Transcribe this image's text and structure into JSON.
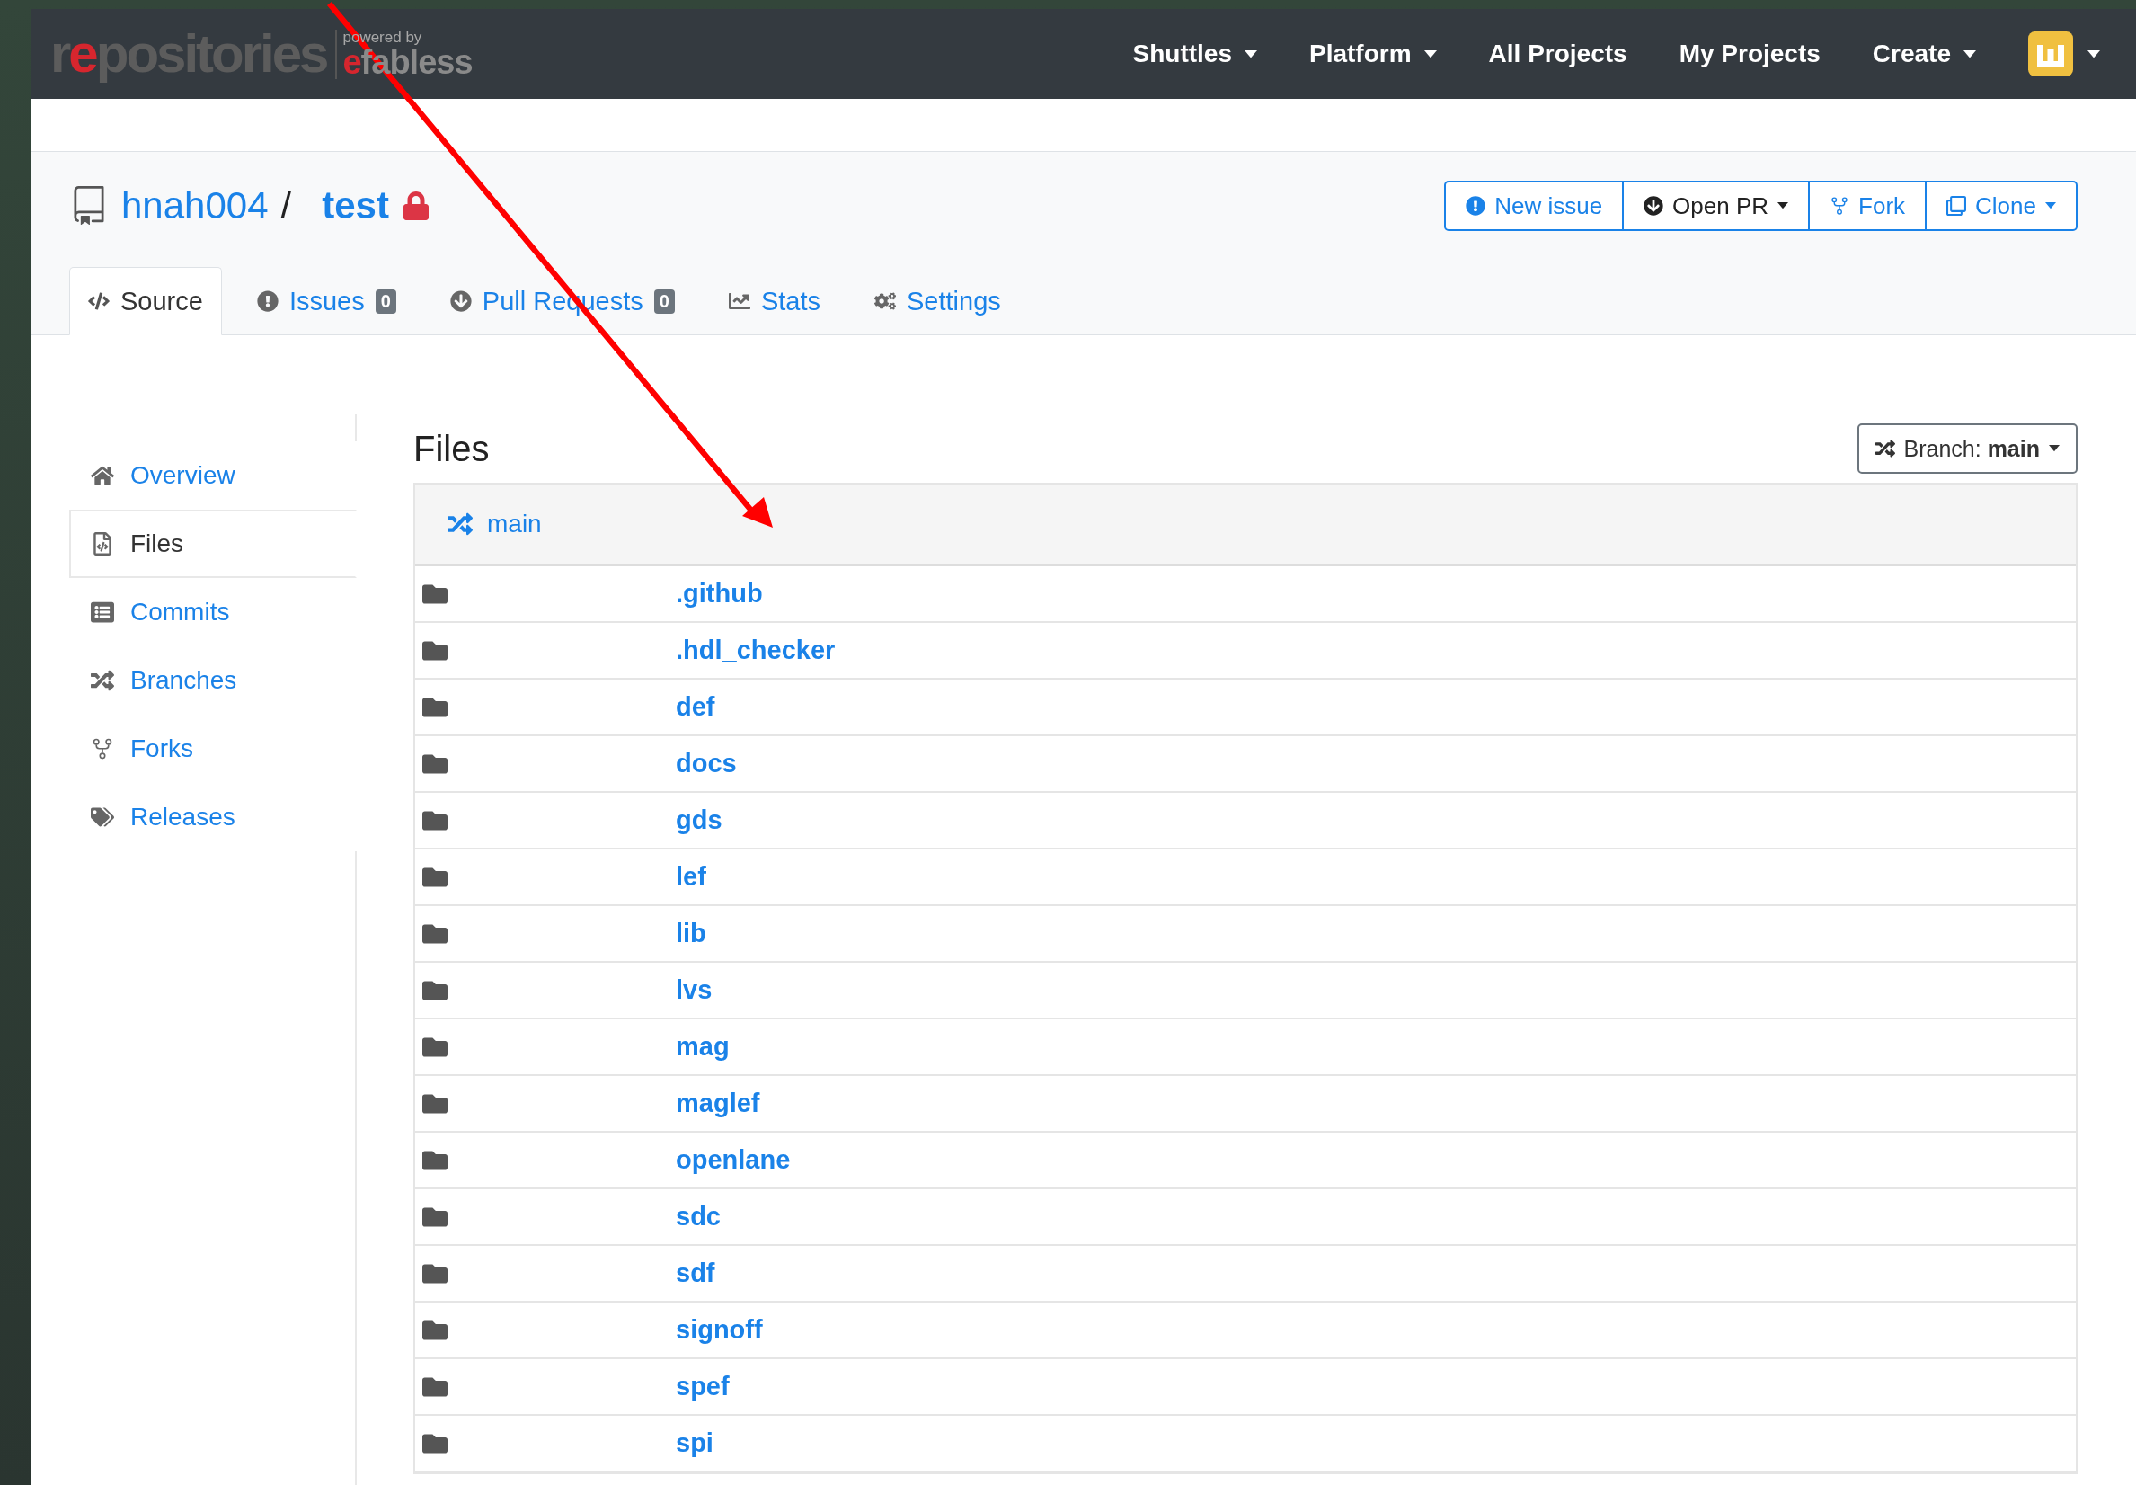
{
  "navbar": {
    "logo": {
      "segments": [
        {
          "text": "r",
          "accent": false
        },
        {
          "text": "e",
          "accent": true
        },
        {
          "text": "positories",
          "accent": false
        }
      ],
      "tagline": "powered by",
      "brand": [
        {
          "text": "e",
          "accent": true
        },
        {
          "text": "fabless",
          "accent": false
        }
      ]
    },
    "items": [
      {
        "label": "Shuttles",
        "caret": true
      },
      {
        "label": "Platform",
        "caret": true
      },
      {
        "label": "All Projects",
        "caret": false
      },
      {
        "label": "My Projects",
        "caret": false
      },
      {
        "label": "Create",
        "caret": true
      }
    ],
    "user_menu": {
      "caret": true
    }
  },
  "repo": {
    "owner": "hnah004",
    "separator": "/",
    "name": "test",
    "private": true
  },
  "actions": [
    {
      "label": "New issue",
      "kind": "outline",
      "caret": false
    },
    {
      "label": "Open PR",
      "kind": "dark",
      "caret": true
    },
    {
      "label": "Fork",
      "kind": "outline",
      "caret": false
    },
    {
      "label": "Clone",
      "kind": "outline",
      "caret": true
    }
  ],
  "tabs": [
    {
      "label": "Source",
      "selected": true
    },
    {
      "label": "Issues",
      "count": "0",
      "selected": false
    },
    {
      "label": "Pull Requests",
      "count": "0",
      "selected": false
    },
    {
      "label": "Stats",
      "selected": false
    },
    {
      "label": "Settings",
      "selected": false
    }
  ],
  "sidebar": {
    "items": [
      {
        "label": "Overview",
        "selected": false
      },
      {
        "label": "Files",
        "selected": true
      },
      {
        "label": "Commits",
        "selected": false
      },
      {
        "label": "Branches",
        "selected": false
      },
      {
        "label": "Forks",
        "selected": false
      },
      {
        "label": "Releases",
        "selected": false
      }
    ]
  },
  "files": {
    "title": "Files",
    "branch_button": {
      "label": "Branch:",
      "value": "main"
    },
    "header": {
      "branch": "main"
    },
    "rows": [
      {
        "name": ".github"
      },
      {
        "name": ".hdl_checker"
      },
      {
        "name": "def"
      },
      {
        "name": "docs"
      },
      {
        "name": "gds"
      },
      {
        "name": "lef"
      },
      {
        "name": "lib"
      },
      {
        "name": "lvs"
      },
      {
        "name": "mag"
      },
      {
        "name": "maglef"
      },
      {
        "name": "openlane"
      },
      {
        "name": "sdc"
      },
      {
        "name": "sdf"
      },
      {
        "name": "signoff"
      },
      {
        "name": "spef"
      },
      {
        "name": "spi"
      }
    ]
  }
}
